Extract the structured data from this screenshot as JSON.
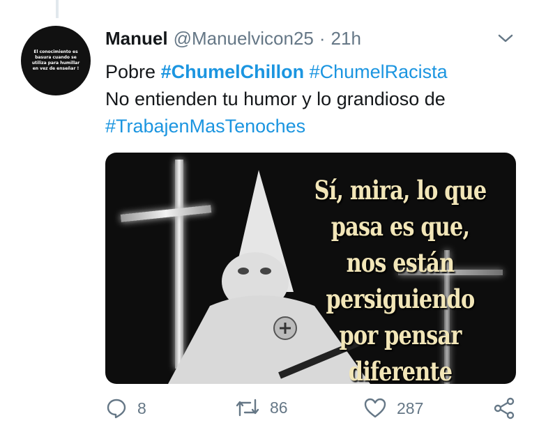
{
  "tweet": {
    "author_name": "Manuel",
    "handle": "@Manuelvicon25",
    "separator": "·",
    "time": "21h",
    "text_word": "Pobre",
    "hashtag1": "#ChumelChillon",
    "hashtag2": "#ChumelRacista",
    "line2": "No entienden tu humor y lo grandioso de",
    "hashtag3": "#TrabajenMasTenoches"
  },
  "avatar": {
    "text": "El conocimiento es basura cuando se utiliza para humillar en vez de enseñar !"
  },
  "media": {
    "caption": "Sí, mira, lo que pasa es que, nos están persiguiendo por pensar diferente"
  },
  "actions": {
    "reply_count": "8",
    "retweet_count": "86",
    "like_count": "287"
  },
  "colors": {
    "link": "#1b95e0",
    "muted": "#657786",
    "text": "#14171a"
  }
}
